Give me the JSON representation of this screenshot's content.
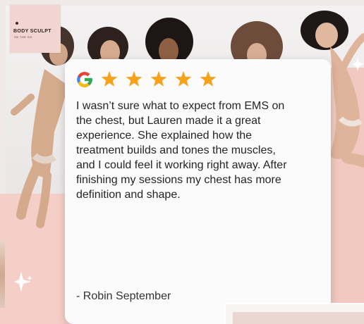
{
  "brand": {
    "logo_title": "BODY SCULPT",
    "logo_subtitle": "ON THE GO"
  },
  "review": {
    "platform_icon": "google-g-icon",
    "rating": 5,
    "rating_max": 5,
    "text": "I wasn’t sure what to expect from EMS on\nthe chest, but Lauren made it a great\nexperience. She explained how the\ntreatment builds and tones the muscles,\nand I could feel it working right away. After\nfinishing my sessions my chest has more\ndefinition and shape.",
    "author": "- Robin September"
  },
  "colors": {
    "star": "#f6a21d",
    "accent_pink": "#f4cfc7",
    "google_blue": "#4285f4",
    "google_red": "#ea4335",
    "google_yellow": "#fbbc05",
    "google_green": "#34a853"
  }
}
